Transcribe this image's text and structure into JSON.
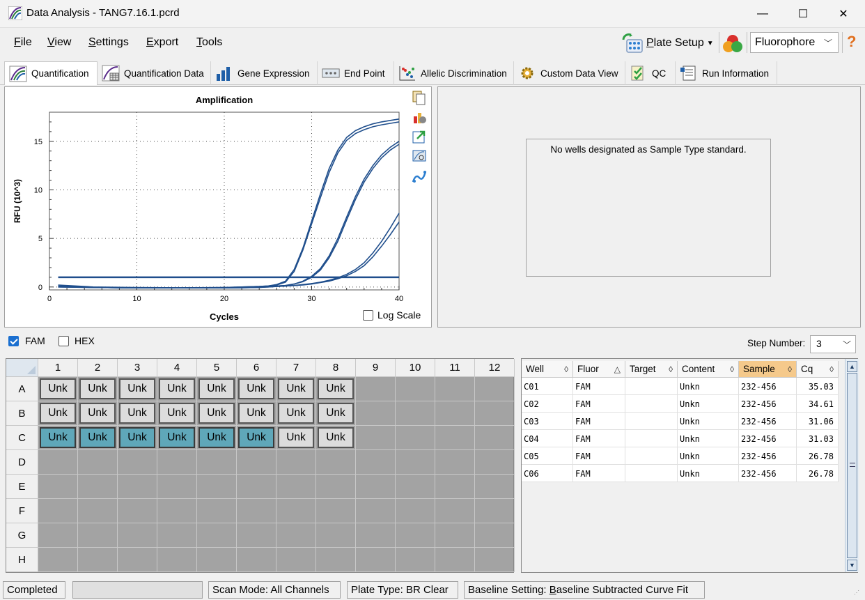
{
  "window": {
    "title": "Data Analysis - TANG7.16.1.pcrd",
    "minimize": "—",
    "maximize": "☐",
    "close": "✕"
  },
  "menu": [
    {
      "label": "File",
      "mnemonic": "F",
      "rest": "ile"
    },
    {
      "label": "View",
      "mnemonic": "V",
      "rest": "iew"
    },
    {
      "label": "Settings",
      "mnemonic": "S",
      "rest": "ettings"
    },
    {
      "label": "Export",
      "mnemonic": "E",
      "rest": "xport"
    },
    {
      "label": "Tools",
      "mnemonic": "T",
      "rest": "ools"
    }
  ],
  "toolbar": {
    "plate_setup_label": "Plate Setup",
    "plate_setup_mnemonic": "P",
    "plate_setup_rest": "late Setup",
    "fluorophore_value": "Fluorophore",
    "help": "?"
  },
  "tabs": [
    {
      "label": "Quantification",
      "active": true
    },
    {
      "label": "Quantification Data"
    },
    {
      "label": "Gene Expression"
    },
    {
      "label": "End Point"
    },
    {
      "label": "Allelic Discrimination"
    },
    {
      "label": "Custom Data View"
    },
    {
      "label": "QC"
    },
    {
      "label": "Run Information"
    }
  ],
  "amplification": {
    "log_scale_label": "Log Scale",
    "log_scale_checked": false
  },
  "chart_data": {
    "type": "line",
    "title": "Amplification",
    "xlabel": "Cycles",
    "ylabel": "RFU (10^3)",
    "xlim": [
      0,
      40
    ],
    "ylim": [
      -0.3,
      18
    ],
    "xticks": [
      0,
      10,
      20,
      30,
      40
    ],
    "yticks": [
      0,
      5,
      10,
      15
    ],
    "grid": true,
    "threshold": 1.0,
    "x": [
      1,
      5,
      10,
      15,
      20,
      22,
      24,
      25,
      26,
      27,
      28,
      29,
      30,
      31,
      32,
      33,
      34,
      35,
      36,
      37,
      38,
      39,
      40
    ],
    "series": [
      {
        "values": [
          0.1,
          -0.05,
          -0.1,
          -0.1,
          -0.05,
          0.0,
          0.05,
          0.1,
          0.25,
          0.6,
          1.8,
          4.0,
          6.8,
          9.6,
          12.2,
          14.1,
          15.4,
          16.1,
          16.5,
          16.8,
          17.0,
          17.15,
          17.3
        ]
      },
      {
        "values": [
          0.2,
          0.0,
          -0.05,
          -0.08,
          -0.05,
          0.0,
          0.05,
          0.1,
          0.2,
          0.5,
          1.6,
          3.8,
          6.5,
          9.2,
          11.8,
          13.8,
          15.1,
          15.8,
          16.2,
          16.5,
          16.7,
          16.85,
          17.0
        ]
      },
      {
        "values": [
          0.05,
          -0.05,
          -0.1,
          -0.1,
          -0.08,
          -0.05,
          0.0,
          0.05,
          0.1,
          0.15,
          0.3,
          0.6,
          1.1,
          1.9,
          3.2,
          5.0,
          7.2,
          9.3,
          11.1,
          12.5,
          13.6,
          14.4,
          15.0
        ]
      },
      {
        "values": [
          0.05,
          -0.05,
          -0.1,
          -0.1,
          -0.08,
          -0.05,
          0.0,
          0.05,
          0.1,
          0.15,
          0.3,
          0.55,
          1.0,
          1.75,
          3.0,
          4.7,
          6.9,
          9.0,
          10.8,
          12.2,
          13.3,
          14.1,
          14.7
        ]
      },
      {
        "values": [
          0.0,
          -0.05,
          -0.1,
          -0.1,
          -0.1,
          -0.08,
          -0.05,
          0.0,
          0.05,
          0.1,
          0.15,
          0.25,
          0.35,
          0.5,
          0.7,
          0.95,
          1.3,
          1.8,
          2.5,
          3.5,
          4.7,
          6.1,
          7.6
        ]
      },
      {
        "values": [
          0.0,
          -0.05,
          -0.1,
          -0.1,
          -0.1,
          -0.08,
          -0.05,
          0.0,
          0.05,
          0.1,
          0.15,
          0.2,
          0.3,
          0.45,
          0.6,
          0.85,
          1.15,
          1.6,
          2.2,
          3.1,
          4.2,
          5.4,
          6.7
        ]
      }
    ]
  },
  "standard_curve": {
    "message": "No wells designated as Sample Type standard."
  },
  "fluors": [
    {
      "label": "FAM",
      "checked": true
    },
    {
      "label": "HEX",
      "checked": false
    }
  ],
  "step_number": {
    "label": "Step Number:",
    "value": "3"
  },
  "plate": {
    "columns": [
      "1",
      "2",
      "3",
      "4",
      "5",
      "6",
      "7",
      "8",
      "9",
      "10",
      "11",
      "12"
    ],
    "rows": [
      "A",
      "B",
      "C",
      "D",
      "E",
      "F",
      "G",
      "H"
    ],
    "wells": [
      {
        "row": "A",
        "col": 1,
        "label": "Unk"
      },
      {
        "row": "A",
        "col": 2,
        "label": "Unk"
      },
      {
        "row": "A",
        "col": 3,
        "label": "Unk"
      },
      {
        "row": "A",
        "col": 4,
        "label": "Unk"
      },
      {
        "row": "A",
        "col": 5,
        "label": "Unk"
      },
      {
        "row": "A",
        "col": 6,
        "label": "Unk"
      },
      {
        "row": "A",
        "col": 7,
        "label": "Unk"
      },
      {
        "row": "A",
        "col": 8,
        "label": "Unk"
      },
      {
        "row": "B",
        "col": 1,
        "label": "Unk"
      },
      {
        "row": "B",
        "col": 2,
        "label": "Unk"
      },
      {
        "row": "B",
        "col": 3,
        "label": "Unk"
      },
      {
        "row": "B",
        "col": 4,
        "label": "Unk"
      },
      {
        "row": "B",
        "col": 5,
        "label": "Unk"
      },
      {
        "row": "B",
        "col": 6,
        "label": "Unk"
      },
      {
        "row": "B",
        "col": 7,
        "label": "Unk"
      },
      {
        "row": "B",
        "col": 8,
        "label": "Unk"
      },
      {
        "row": "C",
        "col": 1,
        "label": "Unk",
        "selected": true
      },
      {
        "row": "C",
        "col": 2,
        "label": "Unk",
        "selected": true
      },
      {
        "row": "C",
        "col": 3,
        "label": "Unk",
        "selected": true
      },
      {
        "row": "C",
        "col": 4,
        "label": "Unk",
        "selected": true
      },
      {
        "row": "C",
        "col": 5,
        "label": "Unk",
        "selected": true
      },
      {
        "row": "C",
        "col": 6,
        "label": "Unk",
        "selected": true
      },
      {
        "row": "C",
        "col": 7,
        "label": "Unk"
      },
      {
        "row": "C",
        "col": 8,
        "label": "Unk"
      }
    ]
  },
  "results_table": {
    "columns": [
      {
        "label": "Well",
        "sort": "◊"
      },
      {
        "label": "Fluor",
        "sort": "△"
      },
      {
        "label": "Target",
        "sort": "◊"
      },
      {
        "label": "Content",
        "sort": "◊"
      },
      {
        "label": "Sample",
        "sort": "◊",
        "sorted": true
      },
      {
        "label": "Cq",
        "sort": "◊"
      }
    ],
    "rows": [
      [
        "C01",
        "FAM",
        "",
        "Unkn",
        "232-456",
        "35.03"
      ],
      [
        "C02",
        "FAM",
        "",
        "Unkn",
        "232-456",
        "34.61"
      ],
      [
        "C03",
        "FAM",
        "",
        "Unkn",
        "232-456",
        "31.06"
      ],
      [
        "C04",
        "FAM",
        "",
        "Unkn",
        "232-456",
        "31.03"
      ],
      [
        "C05",
        "FAM",
        "",
        "Unkn",
        "232-456",
        "26.78"
      ],
      [
        "C06",
        "FAM",
        "",
        "Unkn",
        "232-456",
        "26.78"
      ]
    ]
  },
  "status": {
    "state": "Completed",
    "scan_mode": "Scan Mode: All Channels",
    "plate_type": "Plate Type: BR Clear",
    "baseline_prefix": "Baseline Setting: ",
    "baseline_mnemonic": "B",
    "baseline_rest": "aseline Subtracted Curve Fit"
  },
  "colors": {
    "curve": "#1f4e8c",
    "threshold": "#1f4e8c",
    "selected_well": "#5fa7b9",
    "sorted_header": "#f5c98b"
  }
}
